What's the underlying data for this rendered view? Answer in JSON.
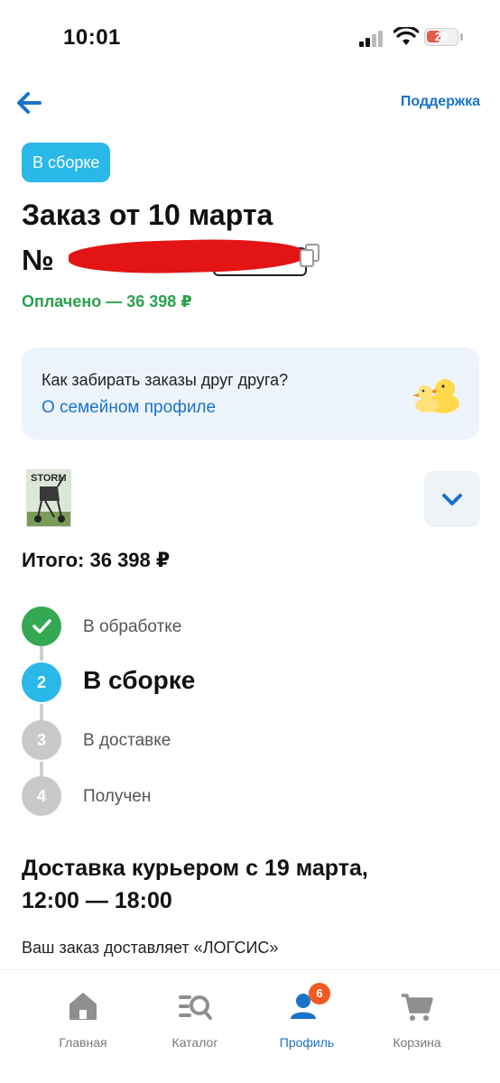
{
  "status_bar": {
    "time": "10:01",
    "battery_level": "20",
    "icons": [
      "signal-icon",
      "wifi-icon",
      "battery-icon"
    ]
  },
  "header": {
    "back_icon": "arrow-left-icon",
    "support_label": "Поддержка"
  },
  "order": {
    "status_chip": "В сборке",
    "title": "Заказ от 10 марта",
    "number_prefix": "№",
    "paid_label": "Оплачено — 36 398 ₽",
    "copy_icon": "copy-icon"
  },
  "family_card": {
    "question": "Как забирать заказы друг друга?",
    "link": "О семейном профиле",
    "icon": "ducks-icon"
  },
  "product": {
    "thumb_text": "STORM",
    "expand_icon": "chevron-down-icon"
  },
  "total": "Итого: 36 398 ₽",
  "steps": [
    {
      "number": "✓",
      "label": "В обработке",
      "state": "done",
      "color": "#34a853"
    },
    {
      "number": "2",
      "label": "В сборке",
      "state": "active",
      "color": "#29b8e8"
    },
    {
      "number": "3",
      "label": "В доставке",
      "state": "pending",
      "color": "#c9c9c9"
    },
    {
      "number": "4",
      "label": "Получен",
      "state": "pending",
      "color": "#c9c9c9"
    }
  ],
  "delivery": {
    "title": "Доставка курьером с 19 марта, 12:00 — 18:00",
    "carrier": "Ваш заказ доставляет «ЛОГСИС»"
  },
  "tabbar": {
    "tabs": [
      {
        "label": "Главная",
        "icon": "home-icon",
        "active": false
      },
      {
        "label": "Каталог",
        "icon": "catalog-search-icon",
        "active": false
      },
      {
        "label": "Профиль",
        "icon": "profile-icon",
        "active": true,
        "badge": "6"
      },
      {
        "label": "Корзина",
        "icon": "cart-icon",
        "active": false
      }
    ]
  },
  "colors": {
    "accent_blue": "#1a73c8",
    "chip_blue": "#29b8e8",
    "paid_green": "#2aa14e",
    "badge_orange": "#f05a22"
  }
}
